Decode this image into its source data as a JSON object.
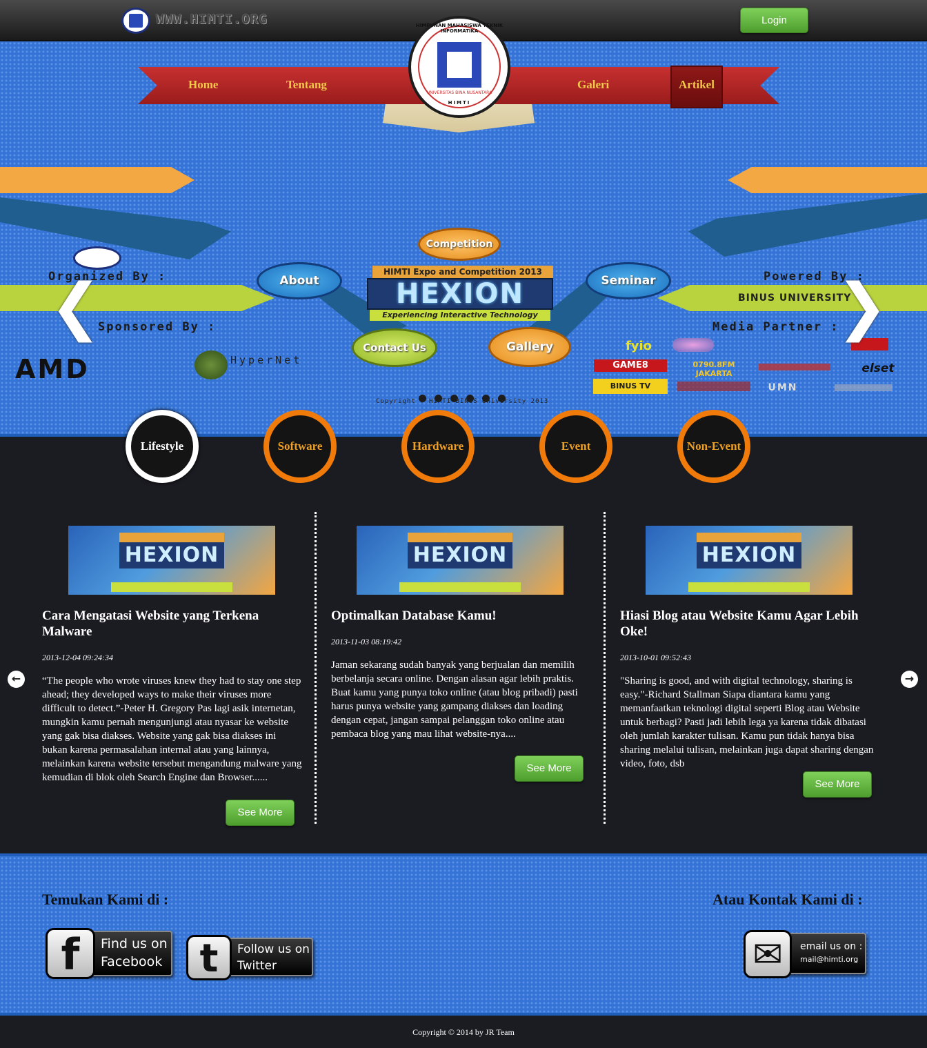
{
  "topbar": {
    "site_url": "WWW.HIMTI.ORG",
    "login_label": "Login"
  },
  "nav": {
    "items": [
      "Home",
      "Tentang",
      "Galeri",
      "Artikel"
    ],
    "active": "Artikel"
  },
  "emblem": {
    "arc_text": "HIMPUNAN MAHASISWA TEKNIK INFORMATIKA",
    "university": "UNIVERSITAS BINA NUSANTARA",
    "acronym": "HIMTI"
  },
  "hero": {
    "organized_by": "Organized By :",
    "sponsored_by": "Sponsored By :",
    "powered_by": "Powered By :",
    "media_partner": "Media Partner :",
    "hexion_top": "HIMTI Expo and Competition 2013",
    "hexion_title": "HEXION",
    "hexion_tagline": "Experiencing Interactive Technology",
    "bubbles": {
      "competition": "Competition",
      "about": "About",
      "seminar": "Seminar",
      "contact": "Contact Us",
      "gallery": "Gallery"
    },
    "sponsors": {
      "amd": "AMD",
      "hypernet": "HyperNet"
    },
    "powered_logo": "BINUS UNIVERSITY",
    "media_partners": [
      "fyio",
      "GAME8",
      "0790.8FM JAKARTA",
      "elset",
      "BINUS TV",
      "UMN"
    ],
    "copyright": "Copyright © HIMTI BINUS University 2013",
    "slide_count": 6,
    "arrows": {
      "prev": "❮",
      "next": "❯"
    }
  },
  "categories": [
    {
      "label": "Lifestyle",
      "active": true
    },
    {
      "label": "Software",
      "active": false
    },
    {
      "label": "Hardware",
      "active": false
    },
    {
      "label": "Event",
      "active": false
    },
    {
      "label": "Non-Event",
      "active": false
    }
  ],
  "articles": [
    {
      "thumb_title": "HEXION",
      "title": "Cara Mengatasi Website yang Terkena Malware",
      "date": "2013-12-04 09:24:34",
      "excerpt": "“The people who wrote viruses knew they had to stay one step ahead; they developed ways to make their viruses more difficult to detect.”-Peter H. Gregory Pas lagi asik internetan, mungkin kamu pernah mengunjungi atau nyasar ke website yang gak bisa diakses. Website yang gak bisa diakses ini bukan karena permasalahan internal atau yang lainnya, melainkan karena website tersebut mengandung malware yang kemudian di blok oleh Search Engine dan Browser......",
      "button": "See More"
    },
    {
      "thumb_title": "HEXION",
      "title": "Optimalkan Database Kamu!",
      "date": "2013-11-03 08:19:42",
      "excerpt": "Jaman sekarang sudah banyak yang berjualan dan memilih berbelanja secara online. Dengan alasan agar lebih praktis. Buat kamu yang punya toko online (atau blog pribadi) pasti harus punya website yang gampang diakses dan loading dengan cepat, jangan sampai pelanggan toko online atau pembaca blog yang mau lihat website-nya....",
      "button": "See More"
    },
    {
      "thumb_title": "HEXION",
      "title": "Hiasi Blog atau Website Kamu Agar Lebih Oke!",
      "date": "2013-10-01 09:52:43",
      "excerpt": "\"Sharing is good, and with digital technology, sharing is easy.\"-Richard Stallman Siapa diantara kamu yang memanfaatkan teknologi digital seperti Blog atau Website untuk berbagi? Pasti jadi lebih lega ya karena tidak dibatasi oleh jumlah karakter tulisan. Kamu pun tidak hanya bisa sharing melalui tulisan, melainkan juga dapat sharing dengan video, foto, dsb",
      "button": "See More"
    }
  ],
  "carousel": {
    "prev": "←",
    "next": "→"
  },
  "footer": {
    "find_heading": "Temukan Kami di :",
    "contact_heading": "Atau Kontak Kami di :",
    "facebook": {
      "icon": "facebook-icon",
      "glyph": "f",
      "line1": "Find us on",
      "line2": "Facebook"
    },
    "twitter": {
      "icon": "twitter-icon",
      "glyph": "t",
      "line1": "Follow us on",
      "line2": "Twitter"
    },
    "email": {
      "icon": "mail-icon",
      "glyph": "✉",
      "line1": "email us on :",
      "line2": "mail@himti.org"
    },
    "copyright": "Copyright © 2014 by JR Team"
  },
  "colors": {
    "hero_blue": "#3574d6",
    "ribbon_red": "#c73030",
    "nav_text": "#f2c84b",
    "category_ring": "#f07b0a",
    "button_green": "#5fb33b",
    "dark_bg": "#1b1c22"
  }
}
